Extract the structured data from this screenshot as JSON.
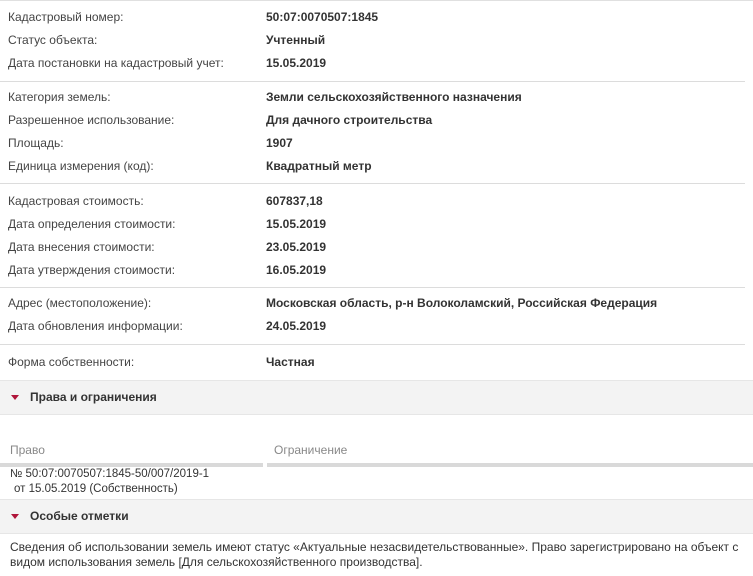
{
  "object_info": [
    {
      "label": "Кадастровый номер:",
      "value": "50:07:0070507:1845"
    },
    {
      "label": "Статус объекта:",
      "value": "Учтенный"
    },
    {
      "label": "Дата постановки на кадастровый учет:",
      "value": "15.05.2019"
    }
  ],
  "land_info": [
    {
      "label": "Категория земель:",
      "value": "Земли сельскохозяйственного назначения"
    },
    {
      "label": "Разрешенное использование:",
      "value": "Для дачного строительства"
    },
    {
      "label": "Площадь:",
      "value": "1907"
    },
    {
      "label": "Единица измерения (код):",
      "value": "Квадратный метр"
    }
  ],
  "cost_info": [
    {
      "label": "Кадастровая стоимость:",
      "value": "607837,18"
    },
    {
      "label": "Дата определения стоимости:",
      "value": "15.05.2019"
    },
    {
      "label": "Дата внесения стоимости:",
      "value": "23.05.2019"
    },
    {
      "label": "Дата утверждения стоимости:",
      "value": "16.05.2019"
    }
  ],
  "address_info": [
    {
      "label": "Адрес (местоположение):",
      "value": "Московская область, р-н Волоколамский, Российская Федерация"
    },
    {
      "label": "Дата обновления информации:",
      "value": "24.05.2019"
    }
  ],
  "ownership": {
    "label": "Форма собственности:",
    "value": "Частная"
  },
  "rights_section": {
    "title": "Права и ограничения",
    "columns": [
      "Право",
      "Ограничение"
    ],
    "right_line1": "№ 50:07:0070507:1845-50/007/2019-1",
    "right_line2": "от 15.05.2019  (Собственность)"
  },
  "special_section": {
    "title": "Особые отметки",
    "text": "Сведения об использовании земель имеют статус «Актуальные незасвидетельствованные». Право зарегистрировано на объект с видом использования земель [Для сельскохозяйственного производства]."
  },
  "colors": {
    "accent": "#b0153a",
    "header_bg": "#f3f3f3",
    "divider": "#dcdcdc"
  },
  "icons": {
    "section_toggle": "triangle-down-icon"
  }
}
